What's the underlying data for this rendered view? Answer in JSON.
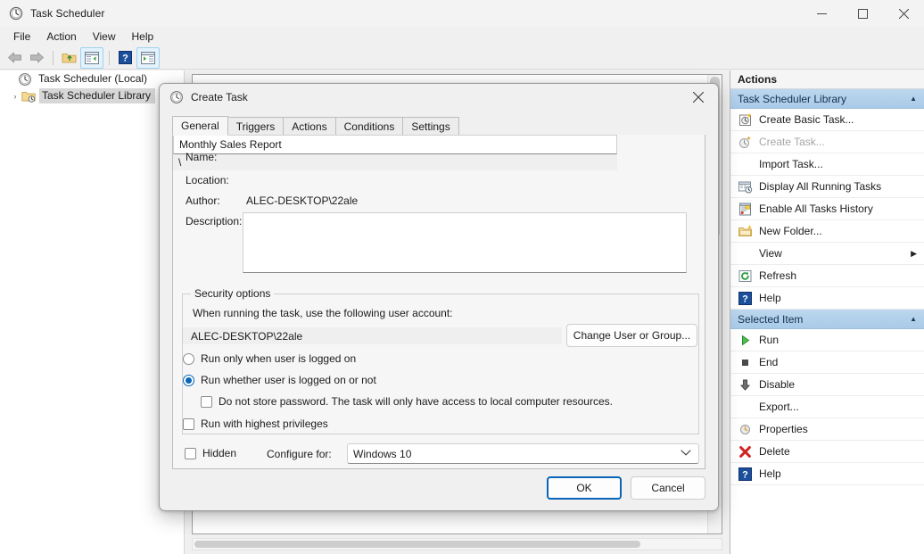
{
  "window": {
    "title": "Task Scheduler",
    "icon": "clock-icon",
    "controls": {
      "minimize": "minimize-icon",
      "maximize": "maximize-icon",
      "close": "close-icon"
    }
  },
  "menubar": {
    "items": [
      {
        "label": "File"
      },
      {
        "label": "Action"
      },
      {
        "label": "View"
      },
      {
        "label": "Help"
      }
    ]
  },
  "toolbar": {
    "buttons": [
      {
        "name": "back-arrow-icon",
        "framed": false
      },
      {
        "name": "forward-arrow-icon",
        "framed": false
      },
      {
        "name": "separator",
        "framed": false
      },
      {
        "name": "up-folder-icon",
        "framed": false
      },
      {
        "name": "show-hide-console-tree-icon",
        "framed": true
      },
      {
        "name": "separator",
        "framed": false
      },
      {
        "name": "help-icon",
        "framed": false
      },
      {
        "name": "show-hide-action-pane-icon",
        "framed": true
      }
    ]
  },
  "tree": {
    "items": [
      {
        "label": "Task Scheduler (Local)",
        "icon": "clock-icon",
        "twisty": "",
        "selected": false,
        "level": 0
      },
      {
        "label": "Task Scheduler Library",
        "icon": "folder-clock-icon",
        "twisty": "›",
        "selected": true,
        "level": 1
      }
    ]
  },
  "actions_pane": {
    "header": "Actions",
    "groups": [
      {
        "title": "Task Scheduler Library",
        "collapse_icon": "chevron-up-icon",
        "items": [
          {
            "label": "Create Basic Task...",
            "icon": "create-basic-task-icon",
            "disabled": false,
            "submenu": false
          },
          {
            "label": "Create Task...",
            "icon": "create-task-icon",
            "disabled": true,
            "submenu": false
          },
          {
            "label": "Import Task...",
            "icon": "",
            "disabled": false,
            "submenu": false
          },
          {
            "label": "Display All Running Tasks",
            "icon": "display-running-tasks-icon",
            "disabled": false,
            "submenu": false
          },
          {
            "label": "Enable All Tasks History",
            "icon": "history-icon",
            "disabled": false,
            "submenu": false
          },
          {
            "label": "New Folder...",
            "icon": "new-folder-icon",
            "disabled": false,
            "submenu": false
          },
          {
            "label": "View",
            "icon": "",
            "disabled": false,
            "submenu": true
          },
          {
            "label": "Refresh",
            "icon": "refresh-icon",
            "disabled": false,
            "submenu": false
          },
          {
            "label": "Help",
            "icon": "help-icon",
            "disabled": false,
            "submenu": false
          }
        ]
      },
      {
        "title": "Selected Item",
        "collapse_icon": "chevron-up-icon",
        "items": [
          {
            "label": "Run",
            "icon": "run-play-icon",
            "disabled": false,
            "submenu": false
          },
          {
            "label": "End",
            "icon": "end-stop-icon",
            "disabled": false,
            "submenu": false
          },
          {
            "label": "Disable",
            "icon": "disable-down-arrow-icon",
            "disabled": false,
            "submenu": false
          },
          {
            "label": "Export...",
            "icon": "",
            "disabled": false,
            "submenu": false
          },
          {
            "label": "Properties",
            "icon": "properties-clock-icon",
            "disabled": false,
            "submenu": false
          },
          {
            "label": "Delete",
            "icon": "delete-x-icon",
            "disabled": false,
            "submenu": false
          },
          {
            "label": "Help",
            "icon": "help-icon",
            "disabled": false,
            "submenu": false
          }
        ]
      }
    ]
  },
  "dialog": {
    "title": "Create Task",
    "icon": "clock-icon",
    "close_icon": "close-icon",
    "tabs": [
      {
        "label": "General",
        "active": true
      },
      {
        "label": "Triggers",
        "active": false
      },
      {
        "label": "Actions",
        "active": false
      },
      {
        "label": "Conditions",
        "active": false
      },
      {
        "label": "Settings",
        "active": false
      }
    ],
    "general": {
      "name_label": "Name:",
      "name_value": "Monthly Sales Report",
      "name_placeholder": "",
      "location_label": "Location:",
      "location_value": "\\",
      "author_label": "Author:",
      "author_value": "ALEC-DESKTOP\\22ale",
      "description_label": "Description:",
      "description_value": "",
      "description_placeholder": "",
      "security": {
        "group_title": "Security options",
        "account_prompt": "When running the task, use the following user account:",
        "account_value": "ALEC-DESKTOP\\22ale",
        "change_user_button": "Change User or Group...",
        "radio_logged_on": "Run only when user is logged on",
        "radio_logged_on_checked": false,
        "radio_whether": "Run whether user is logged on or not",
        "radio_whether_checked": true,
        "check_no_password": "Do not store password.  The task will only have access to local computer resources.",
        "check_no_password_checked": false,
        "check_highest": "Run with highest privileges",
        "check_highest_checked": false
      },
      "hidden_label": "Hidden",
      "hidden_checked": false,
      "configure_for_label": "Configure for:",
      "configure_for_value": "Windows 10",
      "configure_for_chevron": "chevron-down-icon"
    },
    "footer": {
      "ok": "OK",
      "cancel": "Cancel"
    }
  },
  "colors": {
    "accent": "#0a64b8",
    "group_header": "#a9cae8",
    "window_bg": "#f0f0f0",
    "dialog_bg": "#f6f6f6"
  }
}
